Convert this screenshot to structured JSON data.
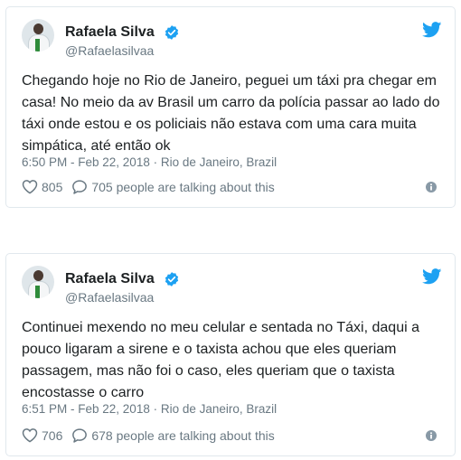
{
  "tweets": [
    {
      "name": "Rafaela Silva",
      "handle": "@Rafaelasilvaa",
      "text": "Chegando hoje no Rio de Janeiro, peguei um táxi pra chegar em casa! No meio da av Brasil um carro da polícia passar ao lado do táxi onde estou e os policiais não estava com uma cara muita simpática, até então ok",
      "timestamp": "6:50 PM - Feb 22, 2018 · Rio de Janeiro, Brazil",
      "likes": "805",
      "talking": "705 people are talking about this"
    },
    {
      "name": "Rafaela Silva",
      "handle": "@Rafaelasilvaa",
      "text": "Continuei mexendo no meu celular e sentada no Táxi, daqui a pouco ligaram a sirene e o taxista achou que eles queriam passagem, mas não foi o caso, eles queriam que o taxista encostasse o carro",
      "timestamp": "6:51 PM - Feb 22, 2018 · Rio de Janeiro, Brazil",
      "likes": "706",
      "talking": "678 people are talking about this"
    }
  ],
  "colors": {
    "twitter_blue": "#1da1f2",
    "meta_gray": "#697882",
    "border": "#e1e8ed"
  },
  "icons": [
    "verified-badge-icon",
    "twitter-bird-icon",
    "heart-icon",
    "reply-bubble-icon",
    "info-icon"
  ]
}
